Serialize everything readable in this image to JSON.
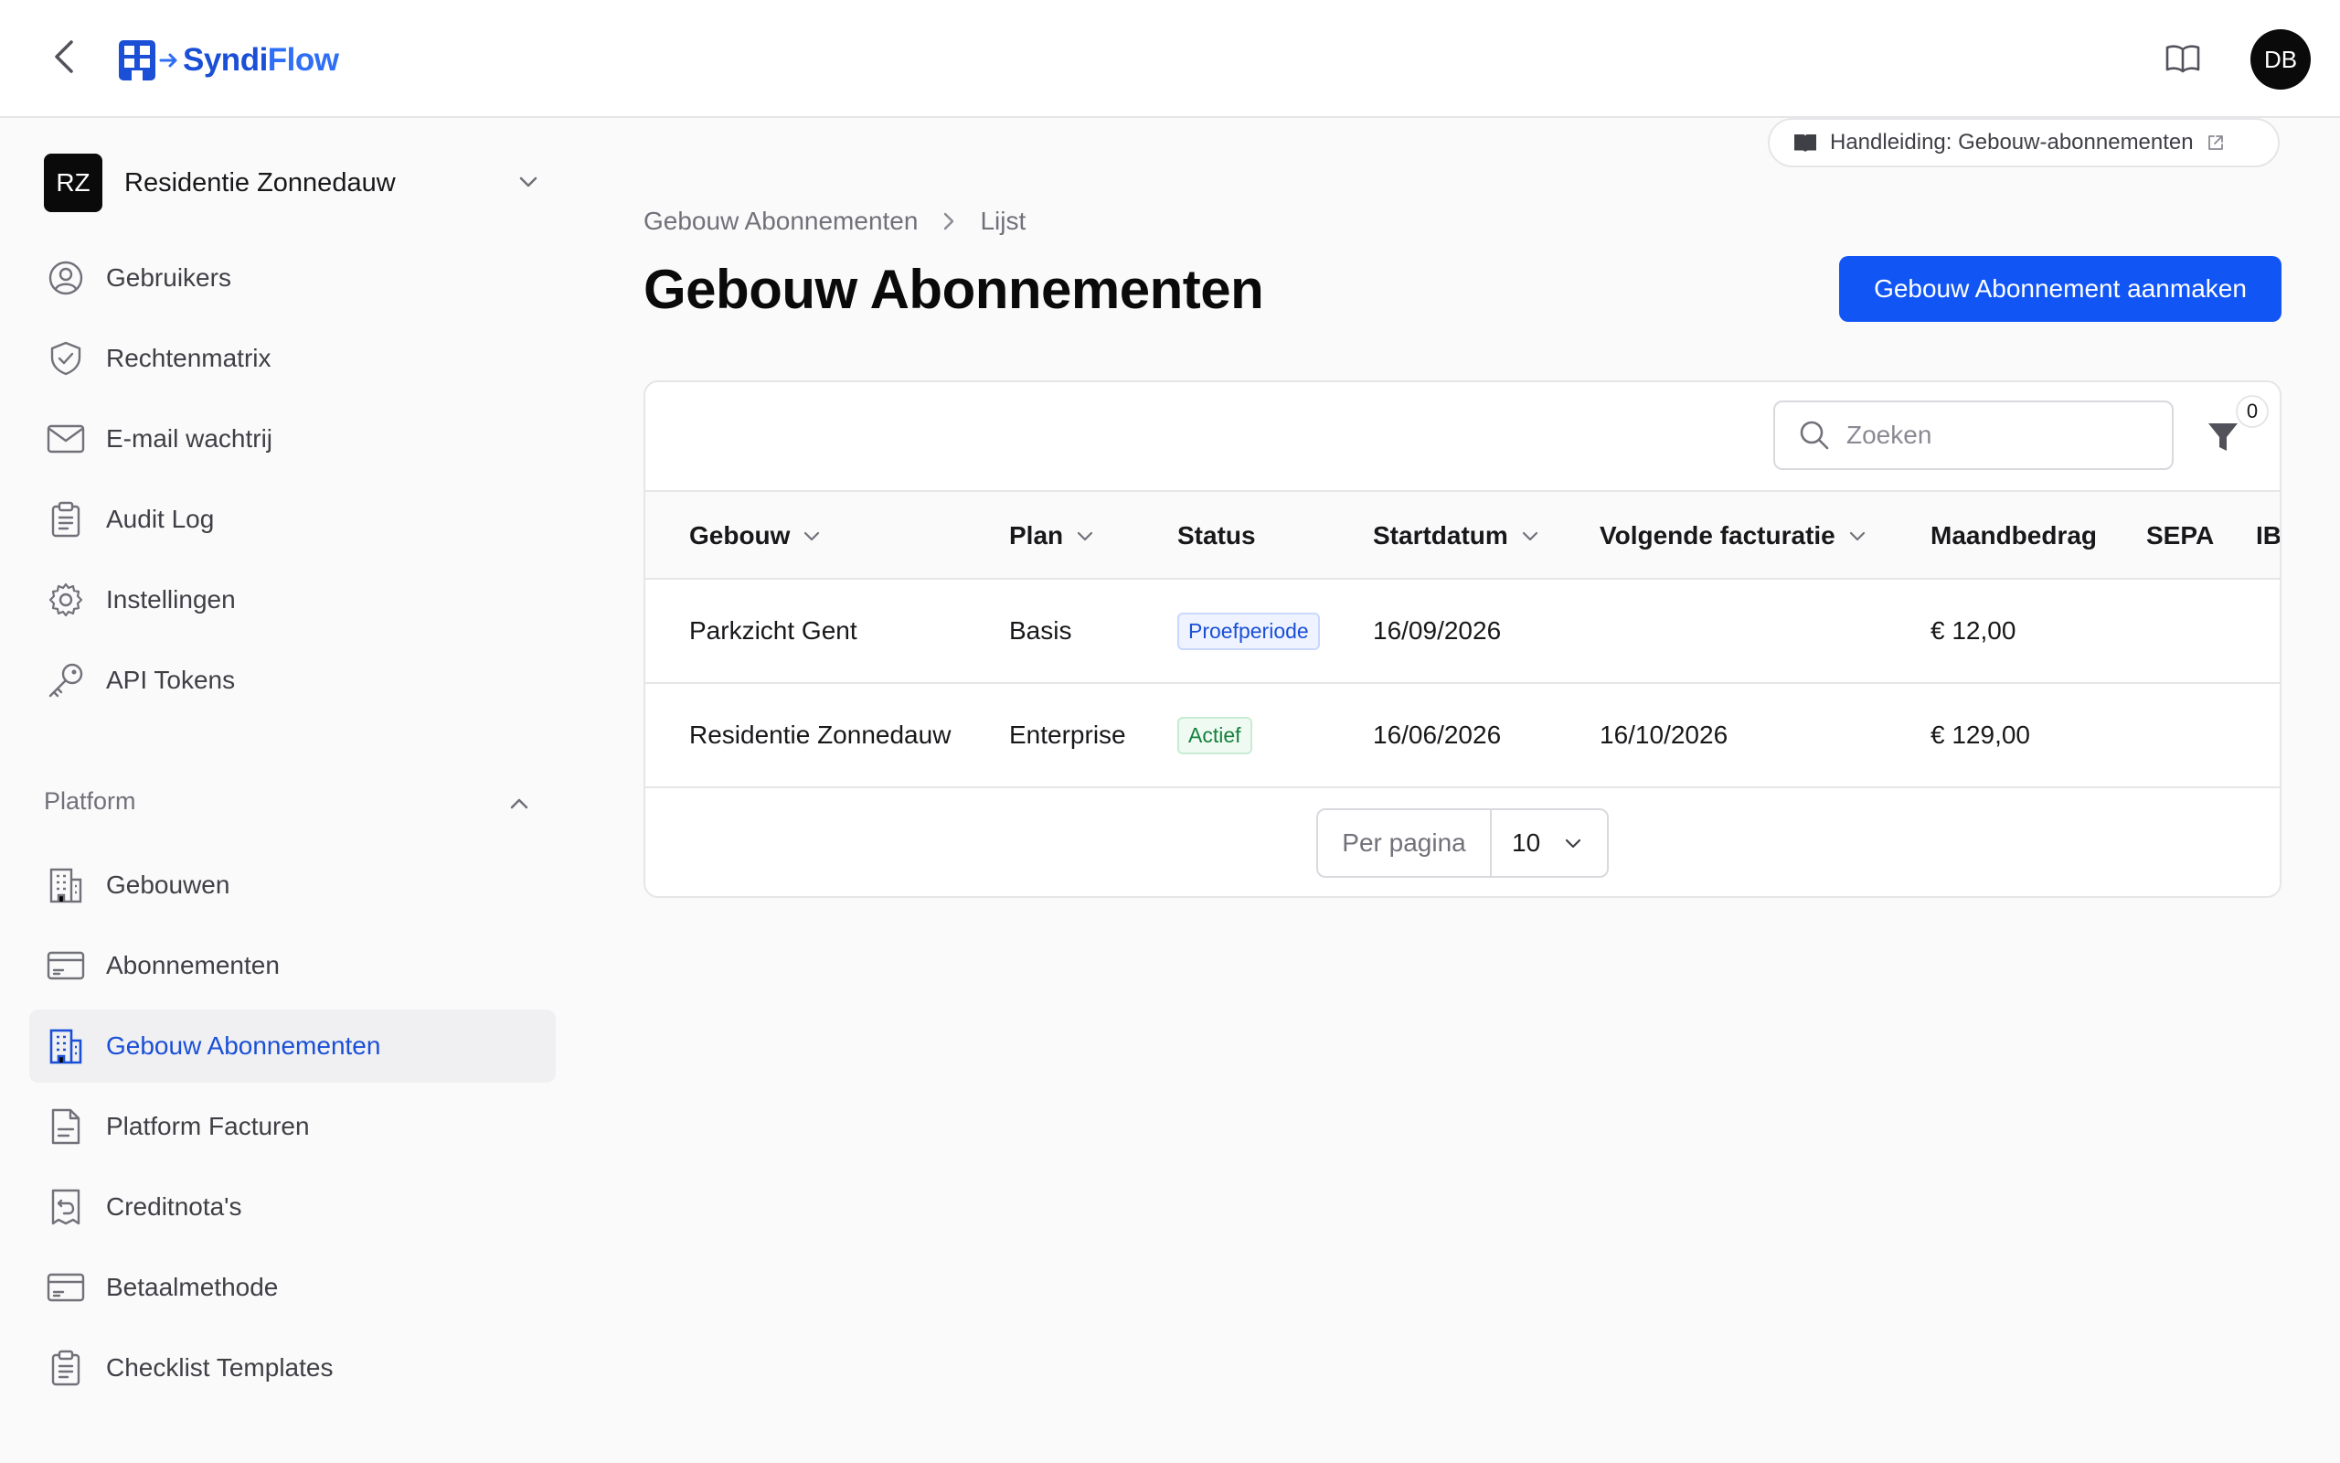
{
  "app": {
    "logo_part1": "Syndi",
    "logo_part2": "Flow",
    "user_initials": "DB"
  },
  "tenant": {
    "initials": "RZ",
    "name": "Residentie Zonnedauw"
  },
  "sidebar": {
    "items": [
      {
        "label": "Gebruikers",
        "icon": "user-circle-icon"
      },
      {
        "label": "Rechtenmatrix",
        "icon": "shield-check-icon"
      },
      {
        "label": "E-mail wachtrij",
        "icon": "mail-icon"
      },
      {
        "label": "Audit Log",
        "icon": "clipboard-list-icon"
      },
      {
        "label": "Instellingen",
        "icon": "gear-icon"
      },
      {
        "label": "API Tokens",
        "icon": "key-icon"
      }
    ],
    "platform_title": "Platform",
    "platform_items": [
      {
        "label": "Gebouwen",
        "icon": "building-icon"
      },
      {
        "label": "Abonnementen",
        "icon": "credit-card-icon"
      },
      {
        "label": "Gebouw Abonnementen",
        "icon": "building-icon",
        "active": true
      },
      {
        "label": "Platform Facturen",
        "icon": "document-icon"
      },
      {
        "label": "Creditnota's",
        "icon": "receipt-refund-icon"
      },
      {
        "label": "Betaalmethode",
        "icon": "credit-card-icon"
      },
      {
        "label": "Checklist Templates",
        "icon": "clipboard-list-icon"
      }
    ]
  },
  "main": {
    "manual_link": "Handleiding: Gebouw-abonnementen",
    "breadcrumb": [
      "Gebouw Abonnementen",
      "Lijst"
    ],
    "title": "Gebouw Abonnementen",
    "create_button": "Gebouw Abonnement aanmaken",
    "search_placeholder": "Zoeken",
    "filter_count": "0",
    "columns": [
      "Gebouw",
      "Plan",
      "Status",
      "Startdatum",
      "Volgende facturatie",
      "Maandbedrag",
      "SEPA",
      "IBAN"
    ],
    "rows": [
      {
        "gebouw": "Parkzicht Gent",
        "plan": "Basis",
        "status": "Proefperiode",
        "status_kind": "trial",
        "startdatum": "16/09/2026",
        "volgende": "",
        "maandbedrag": "€ 12,00"
      },
      {
        "gebouw": "Residentie Zonnedauw",
        "plan": "Enterprise",
        "status": "Actief",
        "status_kind": "active",
        "startdatum": "16/06/2026",
        "volgende": "16/10/2026",
        "maandbedrag": "€ 129,00"
      }
    ],
    "per_page_label": "Per pagina",
    "per_page_value": "10"
  },
  "colors": {
    "accent": "#1156f5",
    "active_nav_text": "#1a4fd6",
    "badge_trial": "#1a4fd6",
    "badge_active": "#15803d"
  }
}
